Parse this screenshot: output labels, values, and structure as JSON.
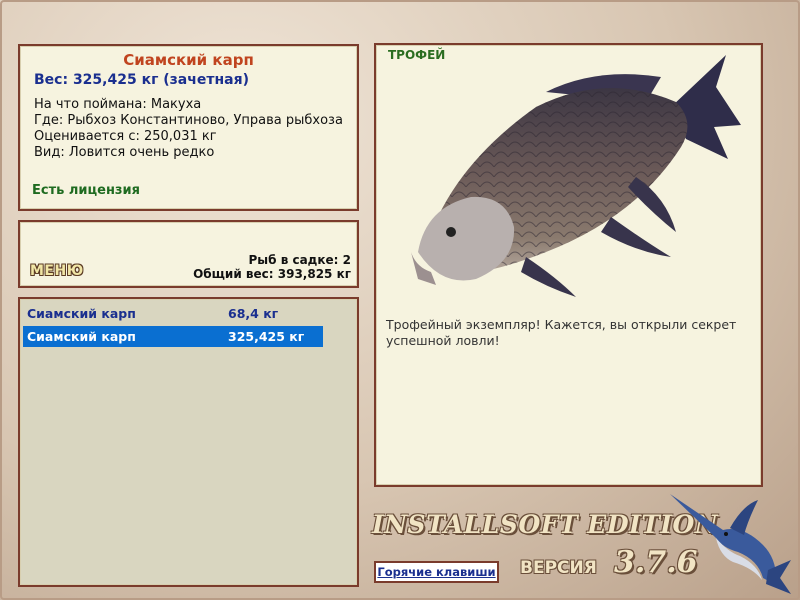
{
  "info": {
    "fish_name": "Сиамский карп",
    "weight_line": "Вес: 325,425 кг (зачетная)",
    "bait": "На что поймана: Макуха",
    "location": "Где: Рыбхоз Константиново, Управа рыбхоза",
    "valued_from": "Оценивается с: 250,031 кг",
    "rarity": "Вид: Ловится очень редко",
    "license": "Есть лицензия"
  },
  "stats": {
    "menu_label": "МЕНЮ",
    "fish_in_keepnet": "Рыб в садке: 2",
    "total_weight": "Общий вес: 393,825 кг"
  },
  "catch_list": [
    {
      "name": "Сиамский карп",
      "weight": "68,4 кг",
      "selected": false
    },
    {
      "name": "Сиамский карп",
      "weight": "325,425 кг",
      "selected": true
    }
  ],
  "trophy": {
    "label": "ТРОФЕЙ",
    "description": "Трофейный экземпляр! Кажется, вы открыли секрет успешной ловли!",
    "image_icon": "siamese-carp-image"
  },
  "footer": {
    "edition": "INSTALLSOFT EDITION",
    "version_word": "ВЕРСИЯ",
    "version_number": "3.7.6",
    "hotkeys_label": "Горячие клавиши",
    "logo_icon": "marlin-logo-icon"
  },
  "colors": {
    "panel_bg": "#f6f3df",
    "panel_border": "#7a3b2c",
    "title": "#c0441f",
    "accent_blue": "#1a2f8f",
    "license_green": "#1e6b20",
    "selection": "#0a6fd1"
  }
}
